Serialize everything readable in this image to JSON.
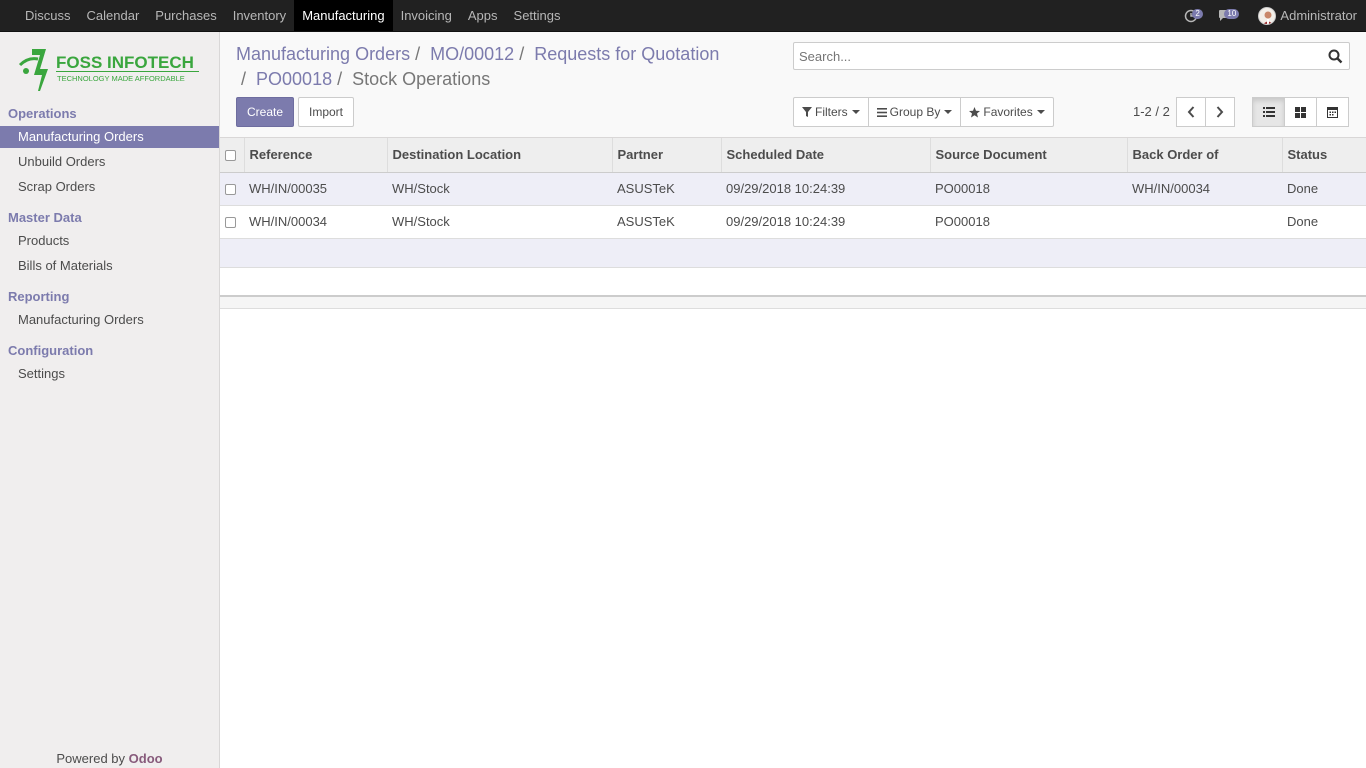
{
  "topbar": {
    "menu": [
      "Discuss",
      "Calendar",
      "Purchases",
      "Inventory",
      "Manufacturing",
      "Invoicing",
      "Apps",
      "Settings"
    ],
    "active_menu": "Manufacturing",
    "activity_count": "2",
    "message_count": "10",
    "user_name": "Administrator"
  },
  "sidebar": {
    "logo_text": "FOSS INFOTECH",
    "logo_tagline": "TECHNOLOGY MADE AFFORDABLE",
    "sections": [
      {
        "title": "Operations",
        "items": [
          "Manufacturing Orders",
          "Unbuild Orders",
          "Scrap Orders"
        ]
      },
      {
        "title": "Master Data",
        "items": [
          "Products",
          "Bills of Materials"
        ]
      },
      {
        "title": "Reporting",
        "items": [
          "Manufacturing Orders"
        ]
      },
      {
        "title": "Configuration",
        "items": [
          "Settings"
        ]
      }
    ],
    "powered_by": "Powered by",
    "powered_brand": "Odoo"
  },
  "breadcrumb": {
    "items": [
      "Manufacturing Orders",
      "MO/00012",
      "Requests for Quotation",
      "PO00018"
    ],
    "current": "Stock Operations",
    "separator": "/"
  },
  "search": {
    "placeholder": "Search..."
  },
  "buttons": {
    "create": "Create",
    "import": "Import"
  },
  "filters": {
    "filters": "Filters",
    "group_by": "Group By",
    "favorites": "Favorites"
  },
  "pager": {
    "value": "1-2 / 2"
  },
  "table": {
    "columns": [
      "Reference",
      "Destination Location",
      "Partner",
      "Scheduled Date",
      "Source Document",
      "Back Order of",
      "Status"
    ],
    "rows": [
      [
        "WH/IN/00035",
        "WH/Stock",
        "ASUSTeK",
        "09/29/2018 10:24:39",
        "PO00018",
        "WH/IN/00034",
        "Done"
      ],
      [
        "WH/IN/00034",
        "WH/Stock",
        "ASUSTeK",
        "09/29/2018 10:24:39",
        "PO00018",
        "",
        "Done"
      ]
    ]
  },
  "colors": {
    "accent": "#7c7bad",
    "topbar": "#212121",
    "sidebar": "#f0eeee",
    "odoo": "#875a7b"
  }
}
